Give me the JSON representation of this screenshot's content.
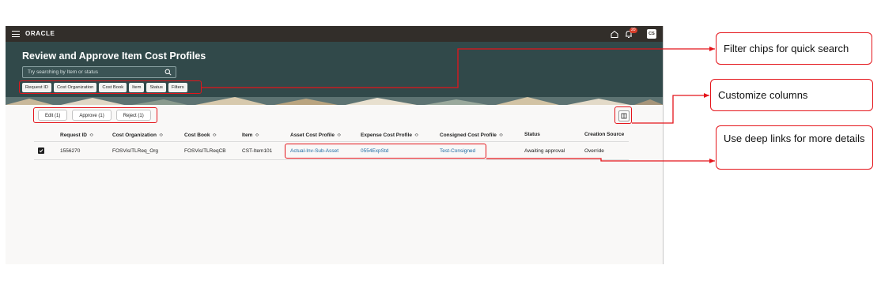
{
  "app": {
    "brand": "ORACLE",
    "notification_count": "20",
    "user_initials": "CS",
    "page_title": "Review and Approve Item Cost Profiles",
    "search": {
      "placeholder": "Try searching by Item or status"
    },
    "filter_chips": [
      "Request ID",
      "Cost Organization",
      "Cost Book",
      "Item",
      "Status",
      "Filters"
    ],
    "toolbar": {
      "edit": "Edit (1)",
      "approve": "Approve (1)",
      "reject": "Reject (1)"
    }
  },
  "table": {
    "columns": [
      "Request ID",
      "Cost Organization",
      "Cost Book",
      "Item",
      "Asset Cost Profile",
      "Expense Cost Profile",
      "Consigned Cost Profile",
      "Status",
      "Creation Source"
    ],
    "sort_glyph": "≎",
    "rows": [
      {
        "selected": true,
        "request_id": "1556270",
        "cost_organization": "FOSVisITLReq_Org",
        "cost_book": "FOSVisITLReqCB",
        "item": "CST-Item101",
        "asset_cost_profile": "Actual-Inv-Sub-Asset",
        "expense_cost_profile": "0554ExpStd",
        "consigned_cost_profile": "Test-Consigned",
        "status": "Awaiting approval",
        "creation_source": "Override"
      }
    ]
  },
  "callouts": {
    "filter_chips": "Filter chips for quick search",
    "customize_columns": "Customize columns",
    "deep_links": "Use deep links for more details"
  },
  "colors": {
    "highlight": "#e4151b",
    "header_bg": "#31494a",
    "topbar_bg": "#322e2a",
    "link": "#1c6aa3"
  },
  "icons": [
    "hamburger-icon",
    "home-icon",
    "bell-icon",
    "search-icon",
    "columns-icon",
    "checkbox-checked-icon"
  ]
}
